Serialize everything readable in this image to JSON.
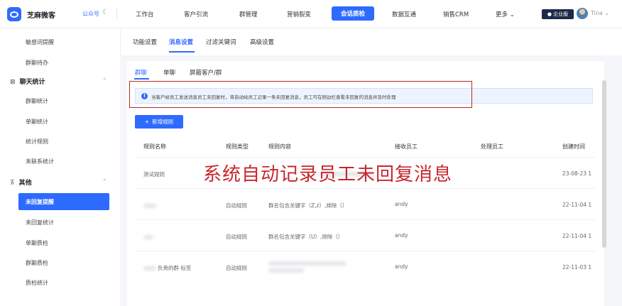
{
  "app": {
    "brand": "芝麻微客",
    "account": "公众号",
    "moon_glyph": "☾",
    "edition": "● 企业版",
    "user": "Tina ⌄"
  },
  "topnav": [
    {
      "label": "工作台"
    },
    {
      "label": "客户引流"
    },
    {
      "label": "群管理"
    },
    {
      "label": "营销裂变"
    },
    {
      "label": "会话质检",
      "active": true
    },
    {
      "label": "数据互通"
    },
    {
      "label": "销售CRM"
    },
    {
      "label": "更多 ⌄"
    }
  ],
  "sidebar": {
    "items_top": [
      "敏感词提醒",
      "群聊待办"
    ],
    "group1": {
      "label": "聊天统计",
      "icon": "⊠",
      "caret": "⌃"
    },
    "group1_items": [
      "群聊统计",
      "单聊统计",
      "统计规则",
      "未联系统计"
    ],
    "group2": {
      "label": "其他",
      "icon": "⊼",
      "caret": "⌃"
    },
    "group2_items": [
      "未回复提醒",
      "未回复统计",
      "单聊质检",
      "群聊质检",
      "质检统计"
    ]
  },
  "subtabs": [
    "功能设置",
    "消息设置",
    "过滤关键词",
    "高级设置"
  ],
  "content_tabs": [
    "群聊",
    "单聊",
    "屏蔽客户/群"
  ],
  "info": {
    "icon": "!",
    "text": "当客户给员工发送消息员工未回复时，将自动给员工记录一条未回复消息，员工可在侧边栏查看未回复的消息并及时处理"
  },
  "add_button": {
    "plus": "+",
    "label": "新增规则"
  },
  "table": {
    "headers": [
      "规则名称",
      "规则类型",
      "规则内容",
      "接收员工",
      "处理员工",
      "创建时间"
    ],
    "rows": [
      {
        "name": "测试规则",
        "type": "",
        "content": "",
        "receiver": "",
        "date": "23-08-23 1"
      },
      {
        "name": "",
        "type": "自动规则",
        "content": "群名包含关键字（Z,z）,排除（）",
        "receiver": "andy",
        "date": "22-11-04 1"
      },
      {
        "name": "",
        "type": "自动规则",
        "content": "群名包含关键字（U）,排除（）",
        "receiver": "andy",
        "date": "22-11-04 1"
      },
      {
        "name": "负责的群 标签",
        "type": "自动规则",
        "content": "",
        "receiver": "andy",
        "date": "22-11-03 1"
      }
    ]
  },
  "overlay_text": "系统自动记录员工未回复消息",
  "colors": {
    "accent": "#2d6bff",
    "highlight_box": "#b52a2a",
    "overlay": "#c8262e"
  }
}
